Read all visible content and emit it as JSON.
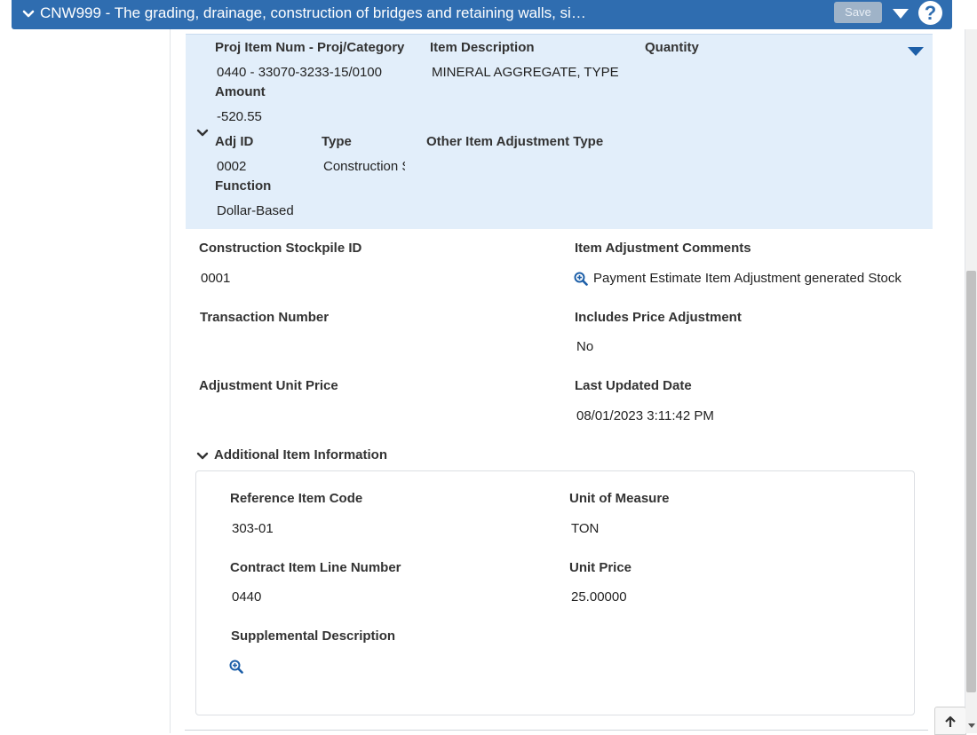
{
  "header": {
    "title": "CNW999 - The grading, drainage, construction of bridges and retaining walls, si…",
    "save_label": "Save",
    "help_label": "?"
  },
  "summary": {
    "proj_item_num_label": "Proj Item Num - Proj/Category",
    "proj_item_num_value": "0440 - 33070-3233-15/0100",
    "item_description_label": "Item Description",
    "item_description_value": "MINERAL AGGREGATE, TYPE",
    "quantity_label": "Quantity",
    "amount_label": "Amount",
    "amount_value": "-520.55",
    "adj_id_label": "Adj ID",
    "adj_id_value": "0002",
    "type_label": "Type",
    "type_value": "Construction S",
    "other_item_adj_type_label": "Other Item Adjustment Type",
    "function_label": "Function",
    "function_value": "Dollar-Based"
  },
  "details": {
    "stockpile_id_label": "Construction Stockpile ID",
    "stockpile_id_value": "0001",
    "item_adj_comments_label": "Item Adjustment Comments",
    "item_adj_comments_value": "Payment Estimate Item Adjustment generated Stock",
    "transaction_number_label": "Transaction Number",
    "includes_price_adj_label": "Includes Price Adjustment",
    "includes_price_adj_value": "No",
    "adj_unit_price_label": "Adjustment Unit Price",
    "last_updated_label": "Last Updated Date",
    "last_updated_value": "08/01/2023 3:11:42 PM"
  },
  "additional": {
    "section_title": "Additional Item Information",
    "ref_item_code_label": "Reference Item Code",
    "ref_item_code_value": "303-01",
    "unit_of_measure_label": "Unit of Measure",
    "unit_of_measure_value": "TON",
    "contract_line_label": "Contract Item Line Number",
    "contract_line_value": "0440",
    "unit_price_label": "Unit Price",
    "unit_price_value": "25.00000",
    "supp_desc_label": "Supplemental Description"
  },
  "icons": {
    "zoom": "magnify-plus-icon",
    "chevron": "chevron-down-icon",
    "scroll_top": "arrow-up-icon"
  },
  "colors": {
    "header_bg": "#2f6db0",
    "summary_bg": "#e2eefa",
    "accent": "#1d5fa8"
  }
}
